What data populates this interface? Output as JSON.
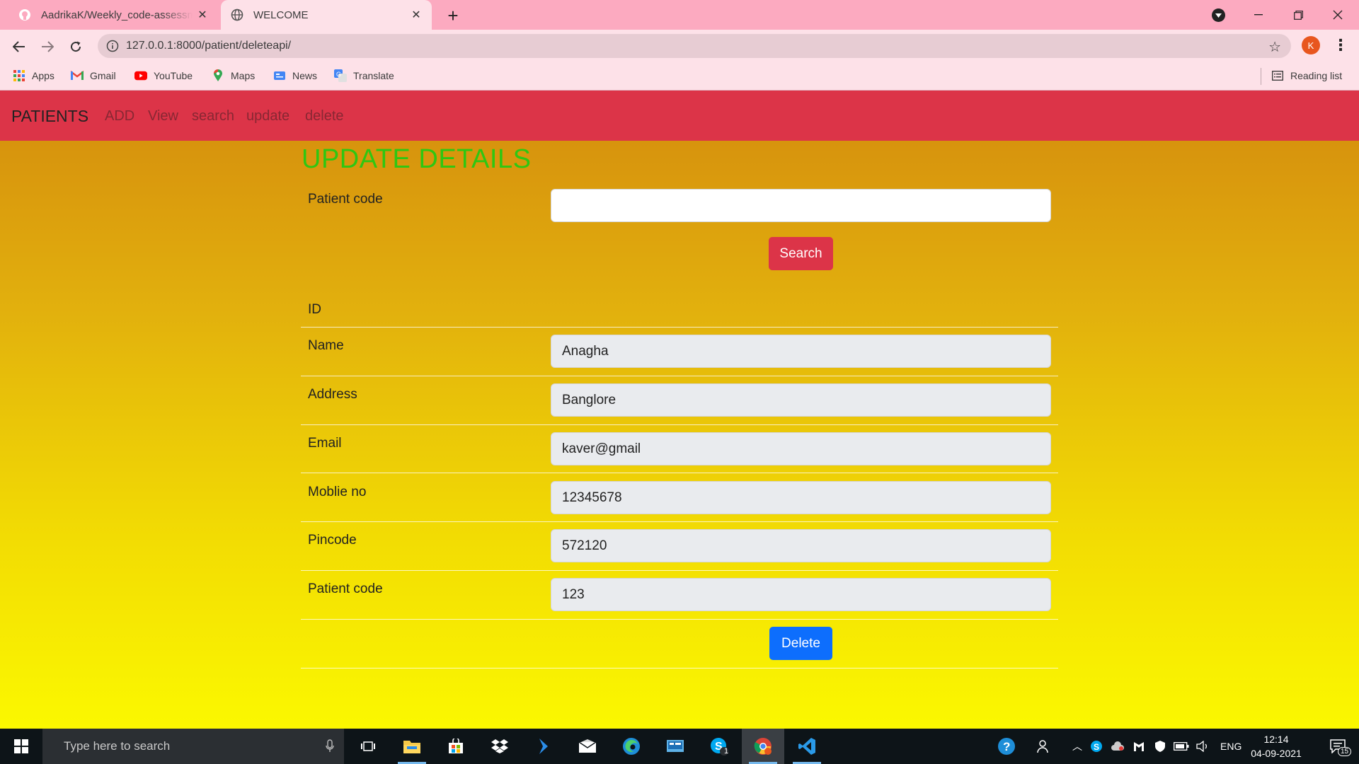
{
  "browser": {
    "tabs": [
      {
        "title": "AadrikaK/Weekly_code-assessment",
        "active": false
      },
      {
        "title": "WELCOME",
        "active": true
      }
    ],
    "url": "127.0.0.1:8000/patient/deleteapi/",
    "profile_initial": "K",
    "bookmarks": [
      "Apps",
      "Gmail",
      "YouTube",
      "Maps",
      "News",
      "Translate"
    ],
    "reading_list": "Reading list"
  },
  "app": {
    "brand": "PATIENTS",
    "nav": [
      "ADD",
      "View",
      "search",
      "update",
      "delete"
    ],
    "heading": "UPDATE DETAILS",
    "search_form": {
      "label": "Patient code",
      "value": "",
      "button": "Search"
    },
    "details": {
      "id_label": "ID",
      "fields": [
        {
          "label": "Name",
          "value": "Anagha"
        },
        {
          "label": "Address",
          "value": "Banglore"
        },
        {
          "label": "Email",
          "value": "kaver@gmail"
        },
        {
          "label": "Moblie no",
          "value": "12345678"
        },
        {
          "label": "Pincode",
          "value": "572120"
        },
        {
          "label": "Patient code",
          "value": "123"
        }
      ],
      "delete_button": "Delete"
    },
    "colors": {
      "navbar": "#dc3448",
      "heading": "#2ec712",
      "search_button": "#dc3448",
      "delete_button": "#0d6efd"
    }
  },
  "taskbar": {
    "search_placeholder": "Type here to search",
    "language": "ENG",
    "time": "12:14",
    "date": "04-09-2021",
    "notifications": "15",
    "skype_badge": "1"
  }
}
